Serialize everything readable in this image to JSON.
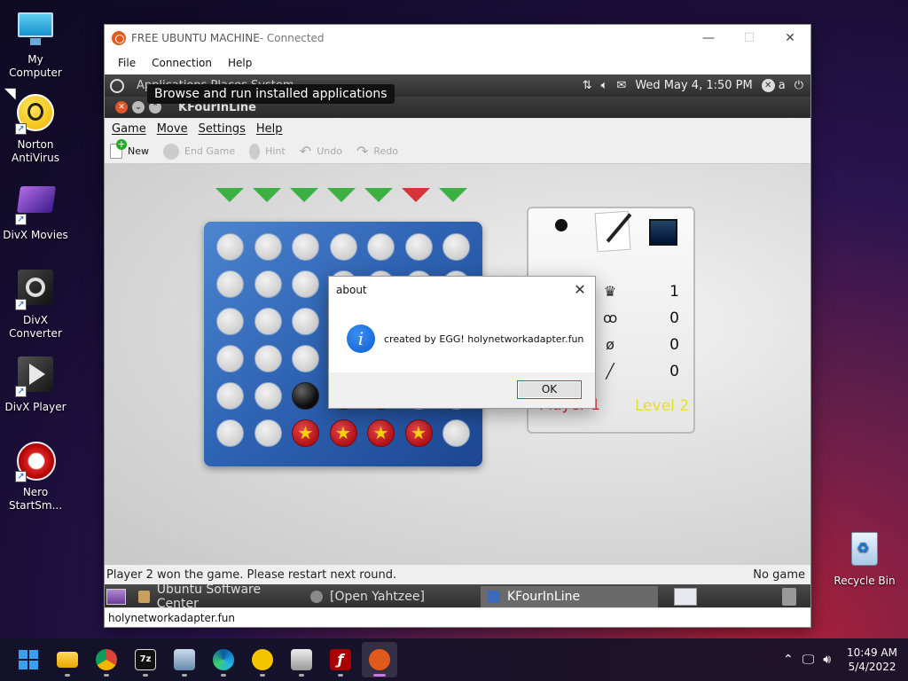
{
  "desktop": {
    "icons": [
      {
        "label": "My Computer"
      },
      {
        "label": "Norton AntiVirus"
      },
      {
        "label": "DivX Movies"
      },
      {
        "label": "DivX Converter"
      },
      {
        "label": "DivX Player"
      },
      {
        "label": "Nero StartSm..."
      },
      {
        "label": "Recycle Bin"
      }
    ]
  },
  "rdp": {
    "title": "FREE UBUNTU MACHINE",
    "title_state": " - Connected",
    "menu": [
      "File",
      "Connection",
      "Help"
    ],
    "status_text": "holynetworkadapter.fun"
  },
  "ubuntu": {
    "panel": {
      "menu_text": "Applications  Places  System",
      "tooltip": "Browse and run installed applications",
      "datetime": "Wed May  4,  1:50 PM",
      "user": "a"
    },
    "app_title": "KFourInLine",
    "menu": [
      "Game",
      "Move",
      "Settings",
      "Help"
    ],
    "toolbar": [
      {
        "label": "New",
        "enabled": true
      },
      {
        "label": "End Game",
        "enabled": false
      },
      {
        "label": "Hint",
        "enabled": false
      },
      {
        "label": "Undo",
        "enabled": false
      },
      {
        "label": "Redo",
        "enabled": false
      }
    ],
    "column_arrows": [
      "green",
      "green",
      "green",
      "green",
      "green",
      "red",
      "green"
    ],
    "board": [
      [
        "e",
        "e",
        "e",
        "e",
        "e",
        "e",
        "e"
      ],
      [
        "e",
        "e",
        "e",
        "e",
        "e",
        "e",
        "e"
      ],
      [
        "e",
        "e",
        "e",
        "e",
        "e",
        "e",
        "e"
      ],
      [
        "e",
        "e",
        "e",
        "e",
        "e",
        "e",
        "e"
      ],
      [
        "e",
        "e",
        "b",
        "b",
        "b",
        "e",
        "e"
      ],
      [
        "e",
        "e",
        "r",
        "r",
        "r",
        "r",
        "e"
      ]
    ],
    "score": {
      "rows": [
        {
          "icon": "trophy-icon",
          "glyph": "♛",
          "right": "1"
        },
        {
          "icon": "tie-icon",
          "glyph": "ꝏ",
          "right": "0"
        },
        {
          "icon": "loss-icon",
          "glyph": "ø",
          "right": "0"
        },
        {
          "icon": "line-icon",
          "glyph": "╱",
          "right": "0"
        }
      ],
      "left_value": "0",
      "player_label": "Player 1",
      "level_label": "Level 2",
      "player_color": "#e0282a",
      "level_color": "#e8e020"
    },
    "status_left": "Player 2 won the game. Please restart next round.",
    "status_right": "No game",
    "tasks": [
      {
        "label": "Ubuntu Software Center",
        "active": false
      },
      {
        "label": "[Open Yahtzee]",
        "active": false
      },
      {
        "label": "KFourInLine",
        "active": true
      }
    ]
  },
  "dialog": {
    "title": "about",
    "message": "created by EGG! holynetworkadapter.fun",
    "ok_label": "OK"
  },
  "taskbar": {
    "time": "10:49 AM",
    "date": "5/4/2022"
  }
}
